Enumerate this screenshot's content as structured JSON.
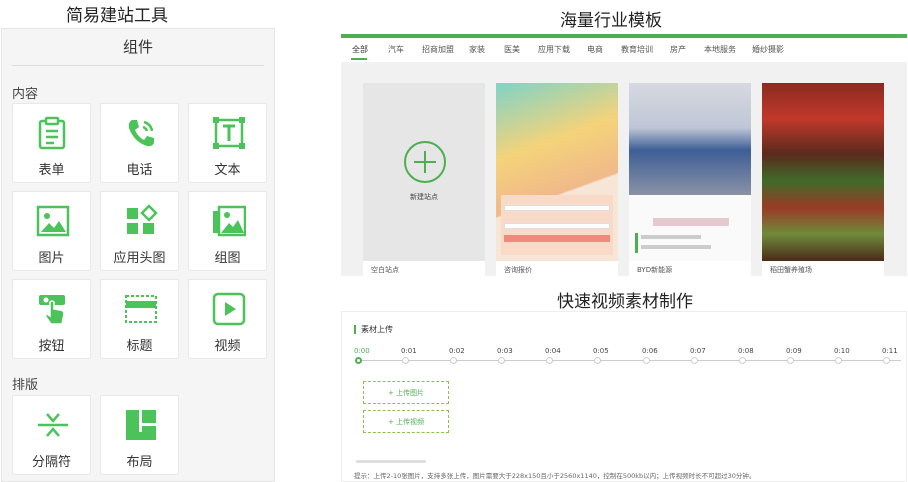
{
  "headings": {
    "left": "简易建站工具",
    "top": "海量行业模板",
    "bottom": "快速视频素材制作"
  },
  "panel": {
    "title": "组件",
    "section_content": "内容",
    "section_layout": "排版",
    "content_items": [
      {
        "label": "表单",
        "icon": "clipboard-icon"
      },
      {
        "label": "电话",
        "icon": "phone-icon"
      },
      {
        "label": "文本",
        "icon": "text-icon"
      },
      {
        "label": "图片",
        "icon": "image-icon"
      },
      {
        "label": "应用头图",
        "icon": "app-grid-icon"
      },
      {
        "label": "组图",
        "icon": "gallery-icon"
      },
      {
        "label": "按钮",
        "icon": "button-tap-icon"
      },
      {
        "label": "标题",
        "icon": "title-icon"
      },
      {
        "label": "视频",
        "icon": "video-icon"
      }
    ],
    "layout_items": [
      {
        "label": "分隔符",
        "icon": "separator-icon"
      },
      {
        "label": "布局",
        "icon": "layout-icon"
      }
    ],
    "accent": "#4cc35a"
  },
  "templates": {
    "tabs": [
      "全部",
      "汽车",
      "招商加盟",
      "家装",
      "医美",
      "应用下载",
      "电商",
      "教育培训",
      "房产",
      "本地服务",
      "婚纱摄影"
    ],
    "active_tab": "全部",
    "new_site_label": "新建站点",
    "cards": [
      "空白站点",
      "咨询报价",
      "BYD新能源",
      "稻田蟹养殖场"
    ],
    "accent": "#4caf50"
  },
  "video": {
    "section_title": "素材上传",
    "ticks": [
      "0:00",
      "0:01",
      "0:02",
      "0:03",
      "0:04",
      "0:05",
      "0:06",
      "0:07",
      "0:08",
      "0:09",
      "0:10",
      "0:11"
    ],
    "upload_image": "+ 上传图片",
    "upload_video": "+ 上传视频",
    "hint": "提示：上传2-10张图片，支持多张上传，图片需要大于228x150且小于2560x1140，控制在500kb以内；上传视频时长不可超过30分钟。"
  }
}
